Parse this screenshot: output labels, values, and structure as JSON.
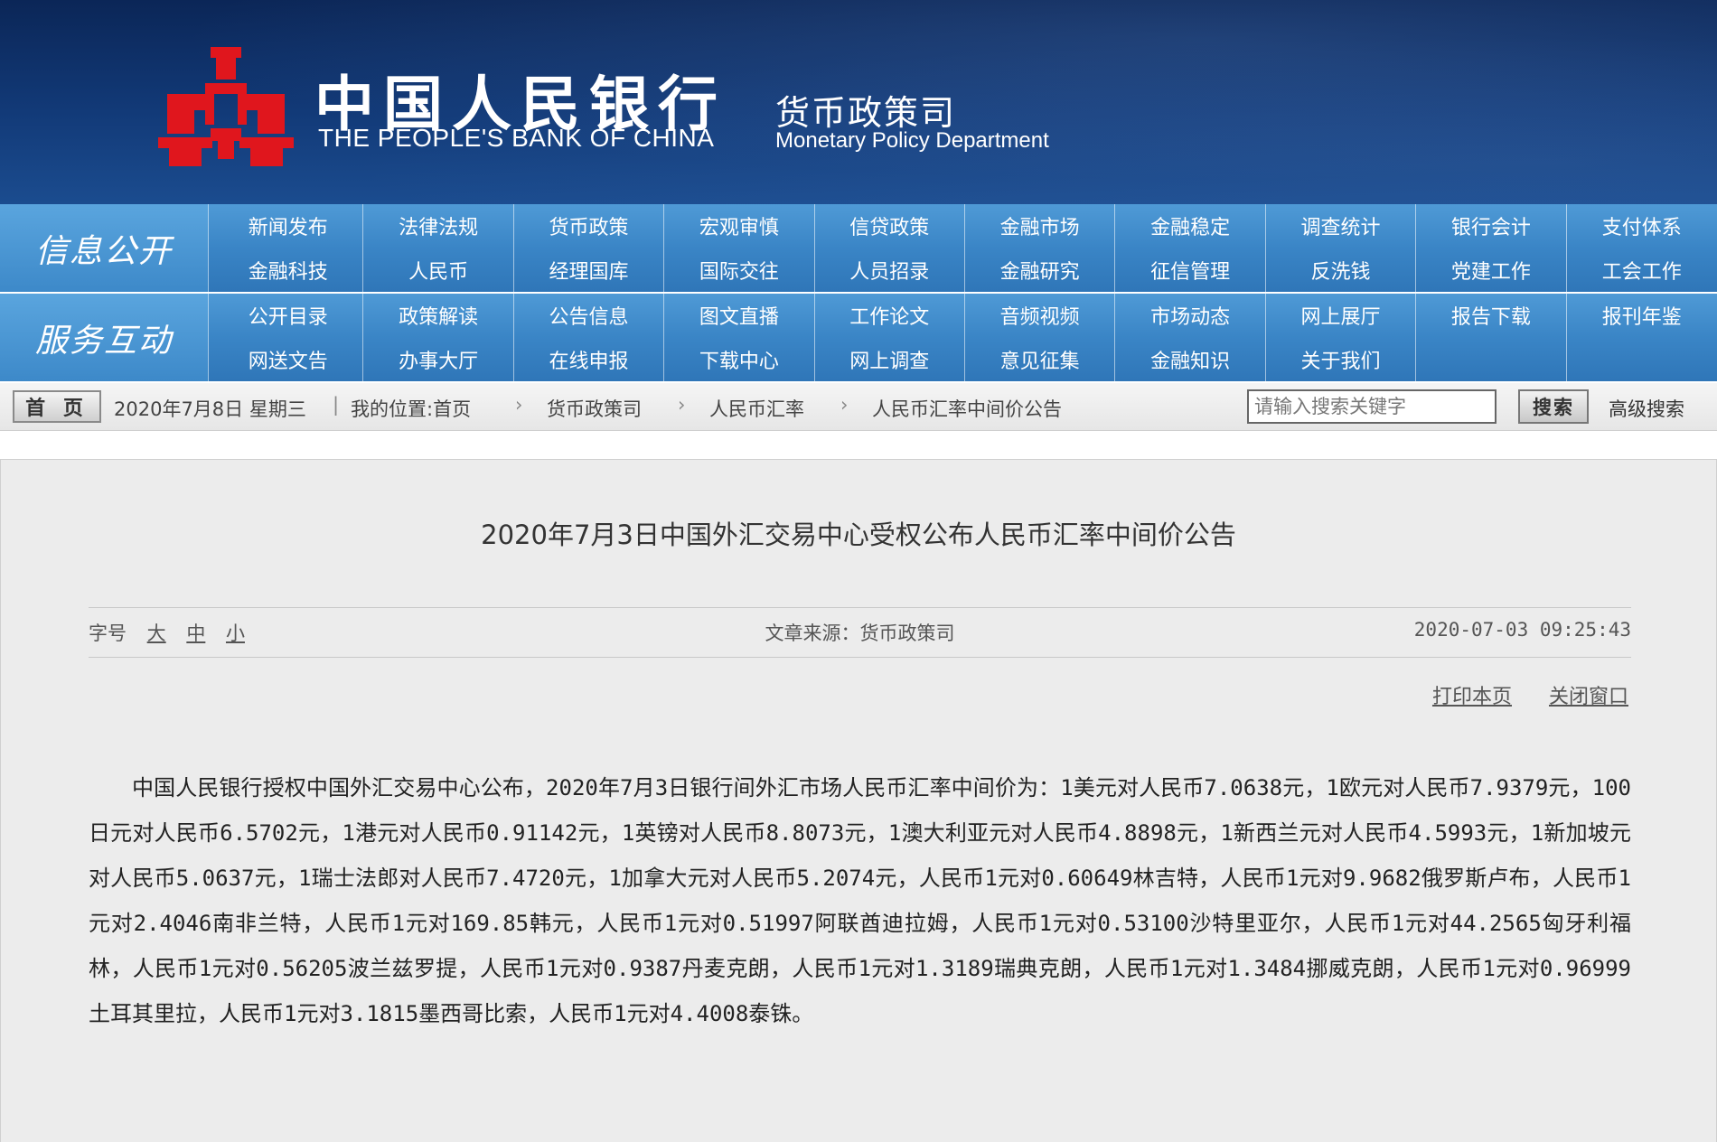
{
  "header": {
    "bank_name_cn": "中国人民银行",
    "bank_name_en": "THE PEOPLE'S BANK OF CHINA",
    "dept_cn": "货币政策司",
    "dept_en": "Monetary Policy Department",
    "colors": {
      "banner": "#123a78",
      "emblem": "#e0161d",
      "nav": "#3a85c6"
    },
    "emblem_icon": "pboc-emblem-icon"
  },
  "nav": {
    "sections": [
      {
        "label": "信息公开",
        "items": [
          "新闻发布",
          "法律法规",
          "货币政策",
          "宏观审慎",
          "信贷政策",
          "金融市场",
          "金融稳定",
          "调查统计",
          "银行会计",
          "支付体系",
          "金融科技",
          "人民币",
          "经理国库",
          "国际交往",
          "人员招录",
          "金融研究",
          "征信管理",
          "反洗钱",
          "党建工作",
          "工会工作"
        ]
      },
      {
        "label": "服务互动",
        "items": [
          "公开目录",
          "政策解读",
          "公告信息",
          "图文直播",
          "工作论文",
          "音频视频",
          "市场动态",
          "网上展厅",
          "报告下载",
          "报刊年鉴",
          "网送文告",
          "办事大厅",
          "在线申报",
          "下载中心",
          "网上调查",
          "意见征集",
          "金融知识",
          "关于我们"
        ]
      }
    ]
  },
  "breadcrumb": {
    "home_label": "首 页",
    "date": "2020年7月8日 星期三",
    "location_prefix": "我的位置:首页",
    "path": [
      "货币政策司",
      "人民币汇率",
      "人民币汇率中间价公告"
    ],
    "search_placeholder": "请输入搜索关键字",
    "search_button": "搜索",
    "advanced_search": "高级搜索"
  },
  "article": {
    "title": "2020年7月3日中国外汇交易中心受权公布人民币汇率中间价公告",
    "font_size_label": "字号",
    "font_sizes": [
      "大",
      "中",
      "小"
    ],
    "source": "文章来源：货币政策司",
    "publish_time": "2020-07-03 09:25:43",
    "print_label": "打印本页",
    "close_label": "关闭窗口",
    "body": "中国人民银行授权中国外汇交易中心公布，2020年7月3日银行间外汇市场人民币汇率中间价为：1美元对人民币7.0638元，1欧元对人民币7.9379元，100日元对人民币6.5702元，1港元对人民币0.91142元，1英镑对人民币8.8073元，1澳大利亚元对人民币4.8898元，1新西兰元对人民币4.5993元，1新加坡元对人民币5.0637元，1瑞士法郎对人民币7.4720元，1加拿大元对人民币5.2074元，人民币1元对0.60649林吉特，人民币1元对9.9682俄罗斯卢布，人民币1元对2.4046南非兰特，人民币1元对169.85韩元，人民币1元对0.51997阿联酋迪拉姆，人民币1元对0.53100沙特里亚尔，人民币1元对44.2565匈牙利福林，人民币1元对0.56205波兰兹罗提，人民币1元对0.9387丹麦克朗，人民币1元对1.3189瑞典克朗，人民币1元对1.3484挪威克朗，人民币1元对0.96999土耳其里拉，人民币1元对3.1815墨西哥比索，人民币1元对4.4008泰铢。"
  }
}
